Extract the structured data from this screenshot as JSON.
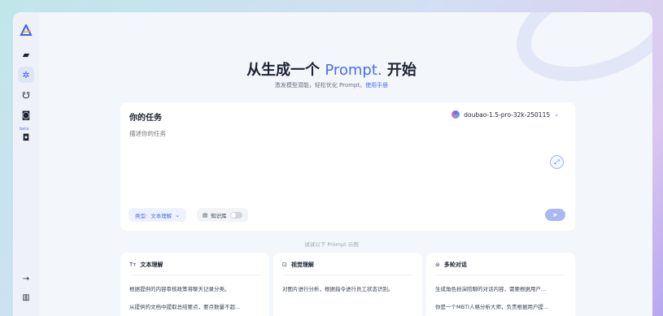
{
  "sidebar": {
    "items": [
      {
        "icon": "logo-icon"
      },
      {
        "icon": "folder-icon"
      },
      {
        "icon": "magic-wand-icon",
        "active": true
      },
      {
        "icon": "bot-icon"
      },
      {
        "icon": "document-icon"
      },
      {
        "icon": "beta-feature-icon",
        "badge": "beta"
      }
    ],
    "bottom": [
      {
        "icon": "arrow-right-icon"
      },
      {
        "icon": "book-icon"
      }
    ]
  },
  "hero": {
    "title_prefix": "从生成一个",
    "title_accent": "Prompt.",
    "title_suffix": "开始",
    "subtitle": "激发模型潜能，轻松优化 Prompt。",
    "manual_link": "使用手册"
  },
  "task": {
    "title": "你的任务",
    "placeholder": "描述你的任务",
    "model": "doubao-1.5-pro-32k-250115",
    "type_label": "类型:",
    "type_value": "文本理解",
    "kb_label": "知识库"
  },
  "examples": {
    "label": "试试以下 Prompt 示例",
    "cards": [
      {
        "icon": "Tт",
        "title": "文本理解",
        "lines": [
          "根据提供的内容审核政策将聊天记录分类。",
          "从提供的文档中提取总结要点，要点数量不超..."
        ]
      },
      {
        "icon": "⊡",
        "title": "视觉理解",
        "lines": [
          "对图片进行分析，根据指令进行员工状态识别。",
          ""
        ]
      },
      {
        "icon": "⊜",
        "title": "多轮对话",
        "lines": [
          "生成角色扮演陪聊的对话内容，需要根据用户...",
          "你是一个MBTI人格分析大师，负责根据用户提..."
        ]
      }
    ]
  }
}
